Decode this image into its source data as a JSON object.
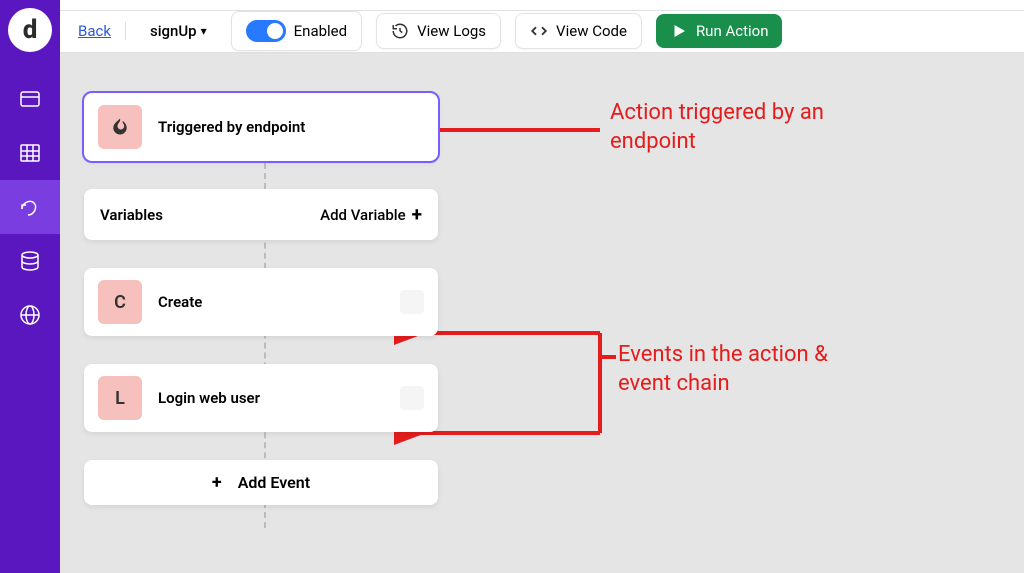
{
  "sidebar": {
    "logo": "d",
    "items": [
      {
        "name": "api-icon"
      },
      {
        "name": "table-icon"
      },
      {
        "name": "actions-icon",
        "active": true
      },
      {
        "name": "database-icon"
      },
      {
        "name": "globe-icon"
      }
    ]
  },
  "toolbar": {
    "back": "Back",
    "action_name": "signUp",
    "enabled_label": "Enabled",
    "view_logs": "View Logs",
    "view_code": "View Code",
    "run_action": "Run Action"
  },
  "flow": {
    "trigger": {
      "badge_glyph": "🔥",
      "title": "Triggered by endpoint"
    },
    "variables_label": "Variables",
    "add_variable_label": "Add Variable",
    "events": [
      {
        "badge": "C",
        "title": "Create"
      },
      {
        "badge": "L",
        "title": "Login web user"
      }
    ],
    "add_event_label": "Add Event"
  },
  "annotations": {
    "trigger_note": "Action triggered by an endpoint",
    "events_note": "Events in the action & event chain"
  },
  "colors": {
    "brand_purple": "#5a16bf",
    "accent_blue": "#2779ff",
    "run_green": "#198f4b",
    "node_badge": "#f6c0bc",
    "annotation_red": "#e41c1c"
  }
}
